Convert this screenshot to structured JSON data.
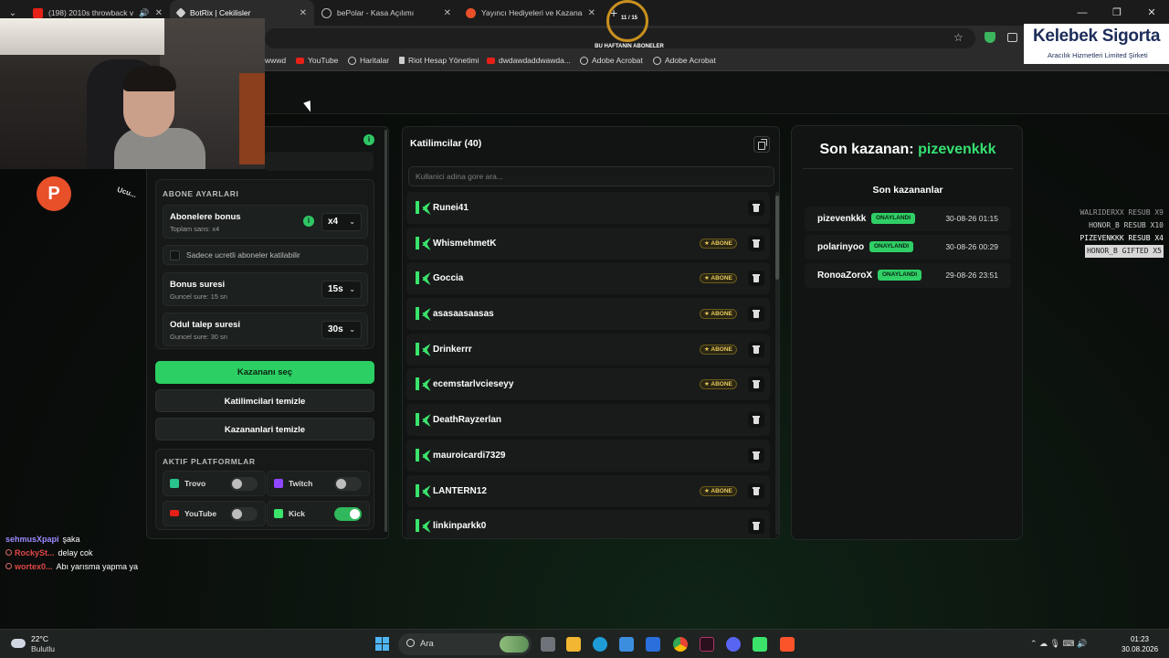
{
  "browser": {
    "tabs": [
      {
        "title": "(198) 2010s throwback vibe",
        "color": "#e62117",
        "active": false,
        "audio": true
      },
      {
        "title": "BotRix | Cekilisler",
        "color": "#cfcfcf",
        "active": true,
        "audio": false
      },
      {
        "title": "bePolar - Kasa Açılımı",
        "color": "#9aa0a6",
        "active": false,
        "audio": false
      },
      {
        "title": "Yayıncı Hediyeleri ve Kazananlar",
        "color": "#e8502a",
        "active": false,
        "audio": false
      }
    ],
    "new_tab": "+",
    "bookmarks": [
      {
        "label": "wwwd",
        "icon": "none"
      },
      {
        "label": "YouTube",
        "icon": "youtube-icon"
      },
      {
        "label": "Haritalar",
        "icon": "globe-icon"
      },
      {
        "label": "Riot Hesap Yönetimi",
        "icon": "riot-icon"
      },
      {
        "label": "dwdawdaddwawda...",
        "icon": "youtube-icon"
      },
      {
        "label": "Adobe Acrobat",
        "icon": "globe-icon"
      },
      {
        "label": "Adobe Acrobat",
        "icon": "globe-icon"
      }
    ]
  },
  "overlay": {
    "sub_goal_count": "11 / 15",
    "sub_goal_percent": 73,
    "sub_goal_label": "BU HAFTANIN ABONELER",
    "sponsor_title": "Kelebek Sigorta",
    "sponsor_subtitle": "Aracılık Hizmetleri Limited Şirketi",
    "badge_letter": "P",
    "ucu_text": "Ucu..."
  },
  "alerts": [
    "WALRIDERXX RESUB X9",
    "HONOR_B RESUB X10",
    "PIZEVENKKK RESUB X4",
    "HONOR_B GIFTED X5"
  ],
  "chat": [
    {
      "user": "sehmusXpapi",
      "message": "şaka",
      "color": "#9b8cff",
      "badge": false
    },
    {
      "user": "RockySt...",
      "message": "delay cok",
      "color": "#e04747",
      "badge": true
    },
    {
      "user": "wortex0...",
      "message": "Abı yarısma yapma ya",
      "color": "#e04747",
      "badge": true
    }
  ],
  "settings": {
    "section_title": "ABONE AYARLARI",
    "sub_bonus_label": "Abonelere bonus",
    "sub_bonus_sub": "Toplam sans: x4",
    "sub_bonus_value": "x4",
    "only_paid_label": "Sadece ucretli aboneler katilabilir",
    "bonus_time_label": "Bonus suresi",
    "bonus_time_sub": "Guncel sure: 15 sn",
    "bonus_time_value": "15s",
    "claim_time_label": "Odul talep suresi",
    "claim_time_sub": "Guncel sure: 30 sn",
    "claim_time_value": "30s",
    "pick_winner": "Kazananı seç",
    "clear_participants": "Katilimcilari temizle",
    "clear_winners": "Kazananlari temizle",
    "platforms_title": "AKTIF PLATFORMLAR",
    "platforms": [
      {
        "name": "Trovo",
        "color": "#29c48c",
        "on": false
      },
      {
        "name": "Twitch",
        "color": "#9146ff",
        "on": false
      },
      {
        "name": "YouTube",
        "color": "#e62117",
        "on": false
      },
      {
        "name": "Kick",
        "color": "#3be36b",
        "on": true
      }
    ]
  },
  "participants": {
    "title": "Katilimcilar (40)",
    "search_placeholder": "Kullanici adina gore ara...",
    "sub_badge": "★ ABONE",
    "rows": [
      {
        "name": "Runei41",
        "sub": false
      },
      {
        "name": "WhismehmetK",
        "sub": true
      },
      {
        "name": "Goccia",
        "sub": true
      },
      {
        "name": "asasaasaasas",
        "sub": true
      },
      {
        "name": "Drinkerrr",
        "sub": true
      },
      {
        "name": "ecemstarlvcieseyy",
        "sub": true
      },
      {
        "name": "DeathRayzerlan",
        "sub": false
      },
      {
        "name": "mauroicardi7329",
        "sub": false
      },
      {
        "name": "LANTERN12",
        "sub": true
      },
      {
        "name": "linkinparkk0",
        "sub": false
      }
    ]
  },
  "winners": {
    "last_label": "Son kazanan:",
    "last_name": "pizevenkkk",
    "list_title": "Son kazananlar",
    "status": "ONAYLANDI",
    "rows": [
      {
        "name": "pizevenkkk",
        "date": "30-08-26 01:15"
      },
      {
        "name": "polarinyoo",
        "date": "30-08-26 00:29"
      },
      {
        "name": "RonoaZoroX",
        "date": "29-08-26 23:51"
      }
    ]
  },
  "taskbar": {
    "temp": "22°C",
    "weather": "Bulutlu",
    "search": "Ara",
    "time": "01:23",
    "date": "30.08.2026"
  }
}
